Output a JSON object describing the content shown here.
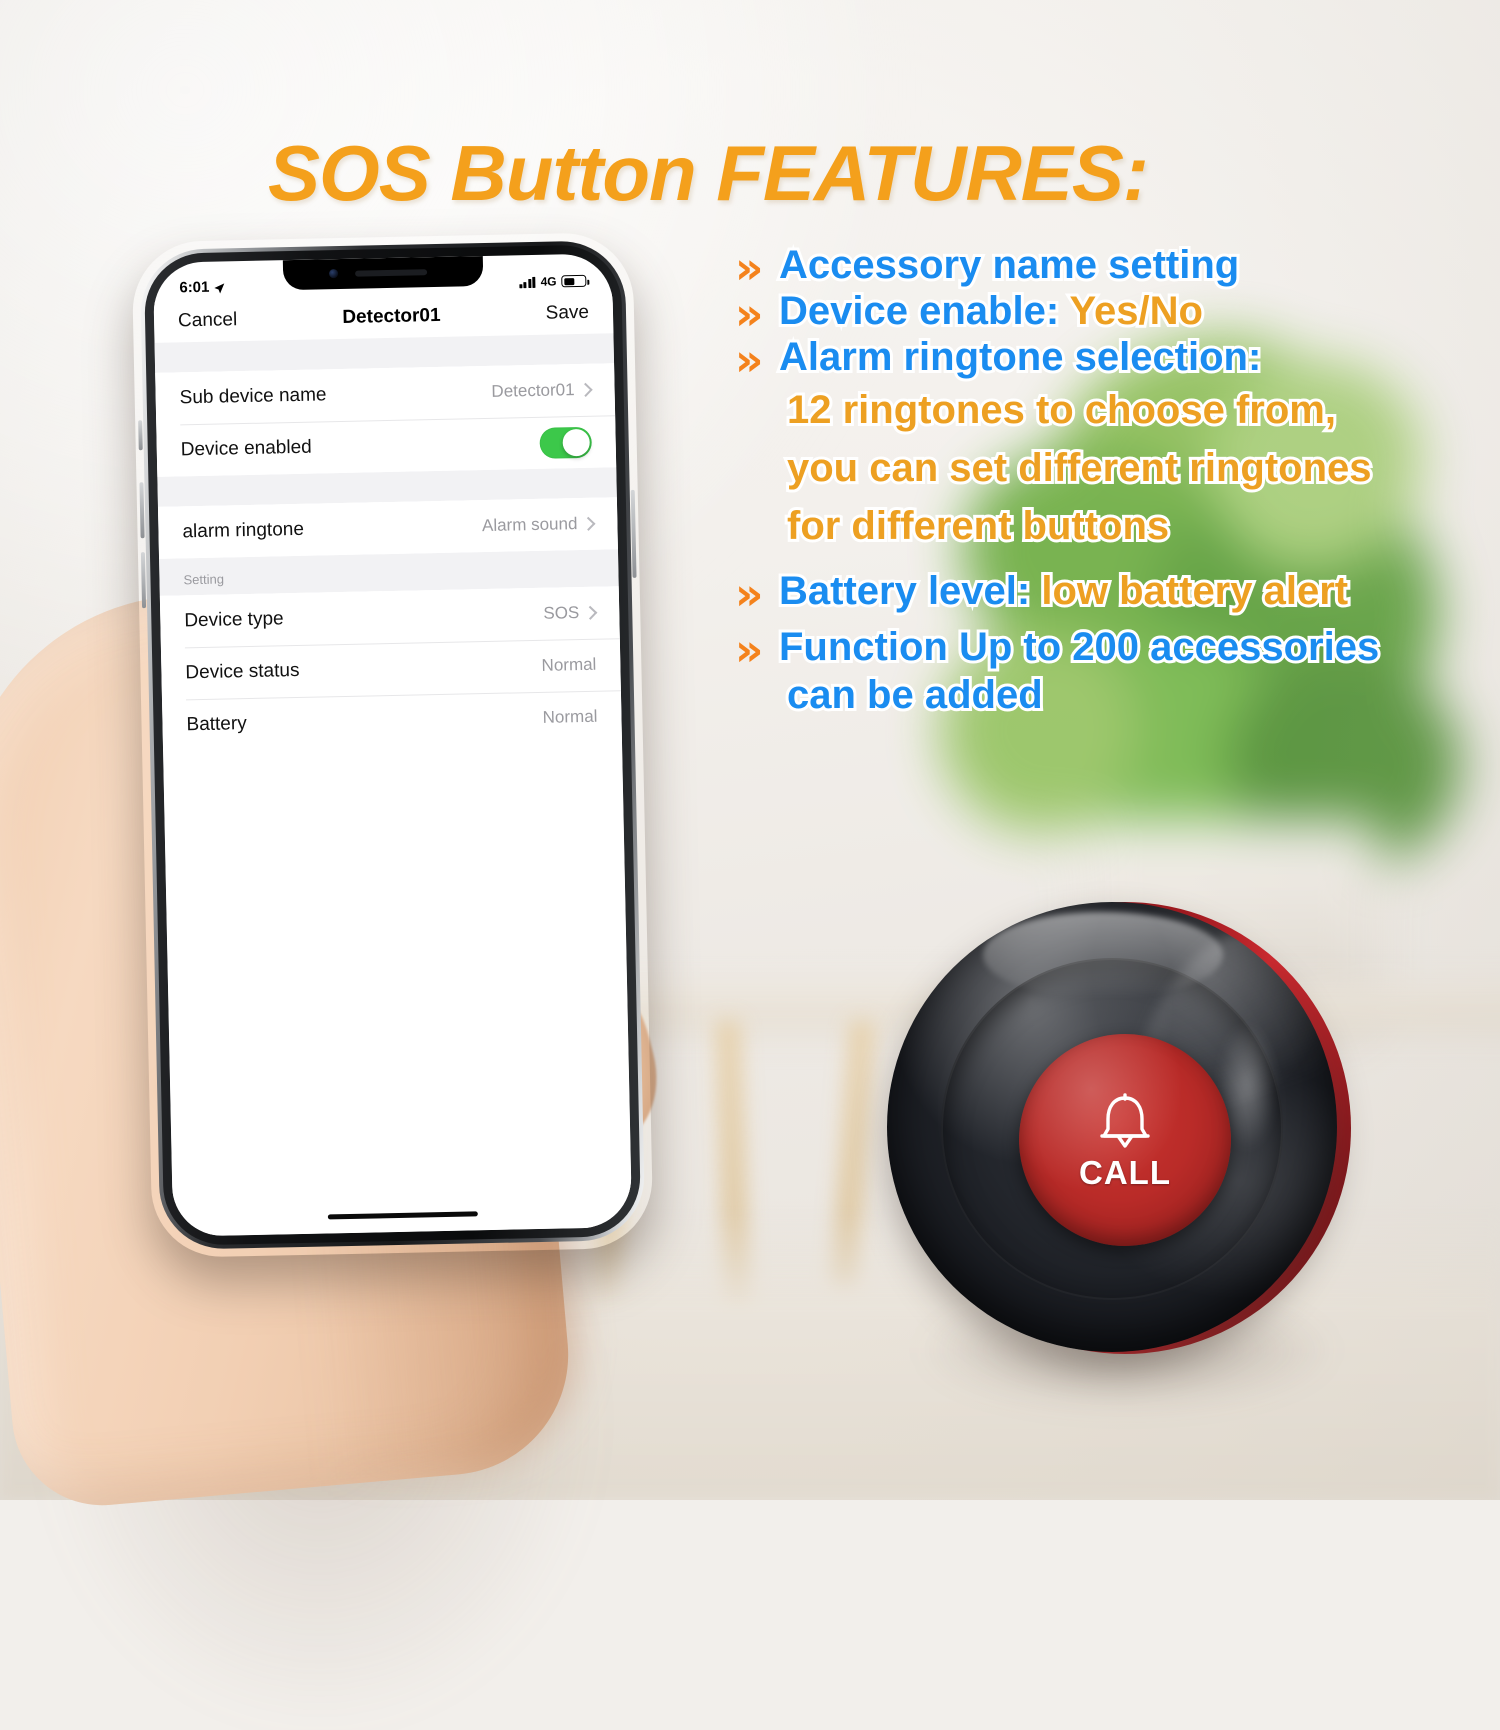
{
  "headline": {
    "text": "SOS Button  FEATURES:",
    "color": "#f4a01c"
  },
  "features": {
    "bullet_glyph": "»",
    "bullet_color": "#f4821c",
    "blue": "#1a8cf0",
    "orange": "#eda022",
    "items": [
      {
        "lead": "Accessory name setting",
        "accent": ""
      },
      {
        "lead": "Device enable: ",
        "accent": "Yes/No"
      },
      {
        "lead": "Alarm ringtone selection:",
        "accent": ""
      },
      {
        "lead": "Battery level: ",
        "accent": "low battery alert"
      },
      {
        "lead": "Function Up to 200 accessories",
        "accent": ""
      }
    ],
    "ringtone_sub_lines": [
      "12 ringtones to choose from,",
      "you can set different  ringtones",
      "for different buttons"
    ],
    "function_sub_line": "can be added"
  },
  "phone": {
    "status_bar": {
      "time": "6:01",
      "location_icon": "location-arrow-icon",
      "signal_icon": "signal-bars-icon",
      "network": "4G",
      "battery_icon": "battery-icon",
      "battery_level_pct": 46
    },
    "nav_bar": {
      "cancel": "Cancel",
      "title": "Detector01",
      "save": "Save"
    },
    "section_1": [
      {
        "label": "Sub device name",
        "value": "Detector01",
        "control": "chevron"
      },
      {
        "label": "Device enabled",
        "value": "",
        "control": "toggle",
        "toggle_on": true
      }
    ],
    "section_2": [
      {
        "label": "alarm ringtone",
        "value": "Alarm sound",
        "control": "chevron"
      }
    ],
    "section_3_header": "Setting",
    "section_3": [
      {
        "label": "Device type",
        "value": "SOS",
        "control": "chevron"
      },
      {
        "label": "Device status",
        "value": "Normal",
        "control": "none"
      },
      {
        "label": "Battery",
        "value": "Normal",
        "control": "none"
      }
    ],
    "toggle_color": "#3cc84a"
  },
  "sos_device": {
    "call_label": "CALL",
    "bell_icon": "bell-icon",
    "body_color": "#16181c",
    "button_color": "#b92b28"
  }
}
